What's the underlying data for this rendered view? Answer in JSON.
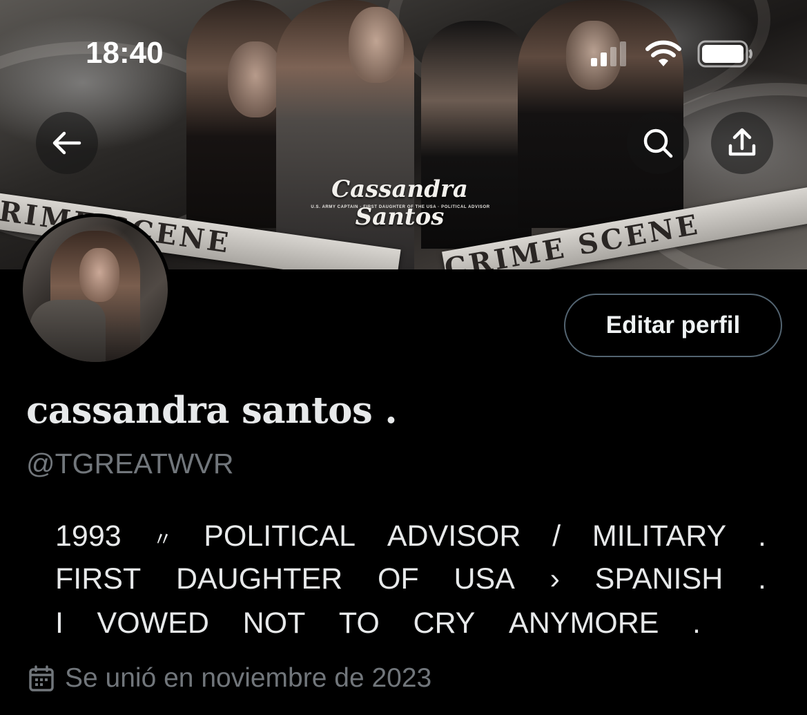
{
  "status_bar": {
    "time": "18:40",
    "icons": [
      "cellular-signal-icon",
      "wifi-icon",
      "battery-icon"
    ]
  },
  "header": {
    "back_icon": "arrow-left-icon",
    "search_icon": "search-icon",
    "share_icon": "share-icon"
  },
  "banner": {
    "script_title": "Cassandra Santos",
    "subtitle": "U.S. ARMY CAPTAIN · FIRST DAUGHTER OF THE USA · POLITICAL ADVISOR",
    "tape_left": "CRIME SCENE",
    "tape_right": "CRIME SCENE"
  },
  "profile": {
    "edit_button": "Editar perfil",
    "display_name": "cassandra santos .",
    "handle": "@TGREATWVR",
    "bio_lines": [
      [
        "1993",
        "〃",
        "POLITICAL",
        "ADVISOR",
        "/",
        "MILITARY",
        "."
      ],
      [
        "FIRST",
        "DAUGHTER",
        "OF",
        "USA",
        "›",
        "SPANISH",
        "."
      ],
      [
        "I",
        "VOWED",
        "NOT",
        "TO",
        "CRY",
        "ANYMORE",
        "."
      ]
    ],
    "joined_icon": "calendar-icon",
    "joined": "Se unió en noviembre de 2023"
  },
  "colors": {
    "background": "#000000",
    "text_primary": "#e7e9ea",
    "text_secondary": "#71767b",
    "button_border": "#536471"
  }
}
